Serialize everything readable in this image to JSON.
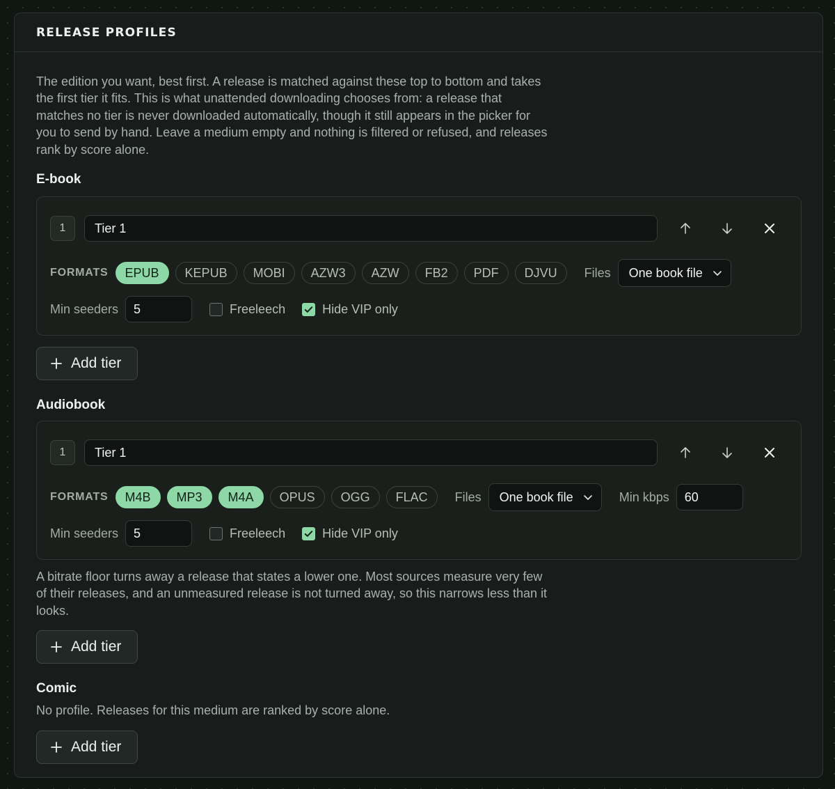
{
  "panel": {
    "title": "RELEASE PROFILES",
    "intro": "The edition you want, best first. A release is matched against these top to bottom and takes the first tier it fits. This is what unattended downloading chooses from: a release that matches no tier is never downloaded automatically, though it still appears in the picker for you to send by hand. Leave a medium empty and nothing is filtered or refused, and releases rank by score alone."
  },
  "ebook": {
    "label": "E-book",
    "tier": {
      "number": "1",
      "name": "Tier 1",
      "formats_label": "FORMATS",
      "formats": [
        {
          "label": "EPUB",
          "selected": true
        },
        {
          "label": "KEPUB",
          "selected": false
        },
        {
          "label": "MOBI",
          "selected": false
        },
        {
          "label": "AZW3",
          "selected": false
        },
        {
          "label": "AZW",
          "selected": false
        },
        {
          "label": "FB2",
          "selected": false
        },
        {
          "label": "PDF",
          "selected": false
        },
        {
          "label": "DJVU",
          "selected": false
        }
      ],
      "files_label": "Files",
      "files_value": "One book file",
      "min_seeders_label": "Min seeders",
      "min_seeders": "5",
      "freeleech_label": "Freeleech",
      "freeleech": false,
      "hide_vip_label": "Hide VIP only",
      "hide_vip": true
    },
    "add_tier": "Add tier"
  },
  "audiobook": {
    "label": "Audiobook",
    "tier": {
      "number": "1",
      "name": "Tier 1",
      "formats_label": "FORMATS",
      "formats": [
        {
          "label": "M4B",
          "selected": true
        },
        {
          "label": "MP3",
          "selected": true
        },
        {
          "label": "M4A",
          "selected": true
        },
        {
          "label": "OPUS",
          "selected": false
        },
        {
          "label": "OGG",
          "selected": false
        },
        {
          "label": "FLAC",
          "selected": false
        }
      ],
      "files_label": "Files",
      "files_value": "One book file",
      "min_kbps_label": "Min kbps",
      "min_kbps": "60",
      "min_seeders_label": "Min seeders",
      "min_seeders": "5",
      "freeleech_label": "Freeleech",
      "freeleech": false,
      "hide_vip_label": "Hide VIP only",
      "hide_vip": true
    },
    "note": "A bitrate floor turns away a release that states a lower one. Most sources measure very few of their releases, and an unmeasured release is not turned away, so this narrows less than it looks.",
    "add_tier": "Add tier"
  },
  "comic": {
    "label": "Comic",
    "empty": "No profile. Releases for this medium are ranked by score alone.",
    "add_tier": "Add tier"
  },
  "icons": {
    "move_up": "arrow-up-icon",
    "move_down": "arrow-down-icon",
    "remove": "close-icon",
    "add": "plus-icon",
    "dropdown": "chevron-down-icon",
    "checked": "check-icon"
  },
  "colors": {
    "accent": "#8ed8a7",
    "panel": "#181c1a",
    "background": "#101612"
  }
}
